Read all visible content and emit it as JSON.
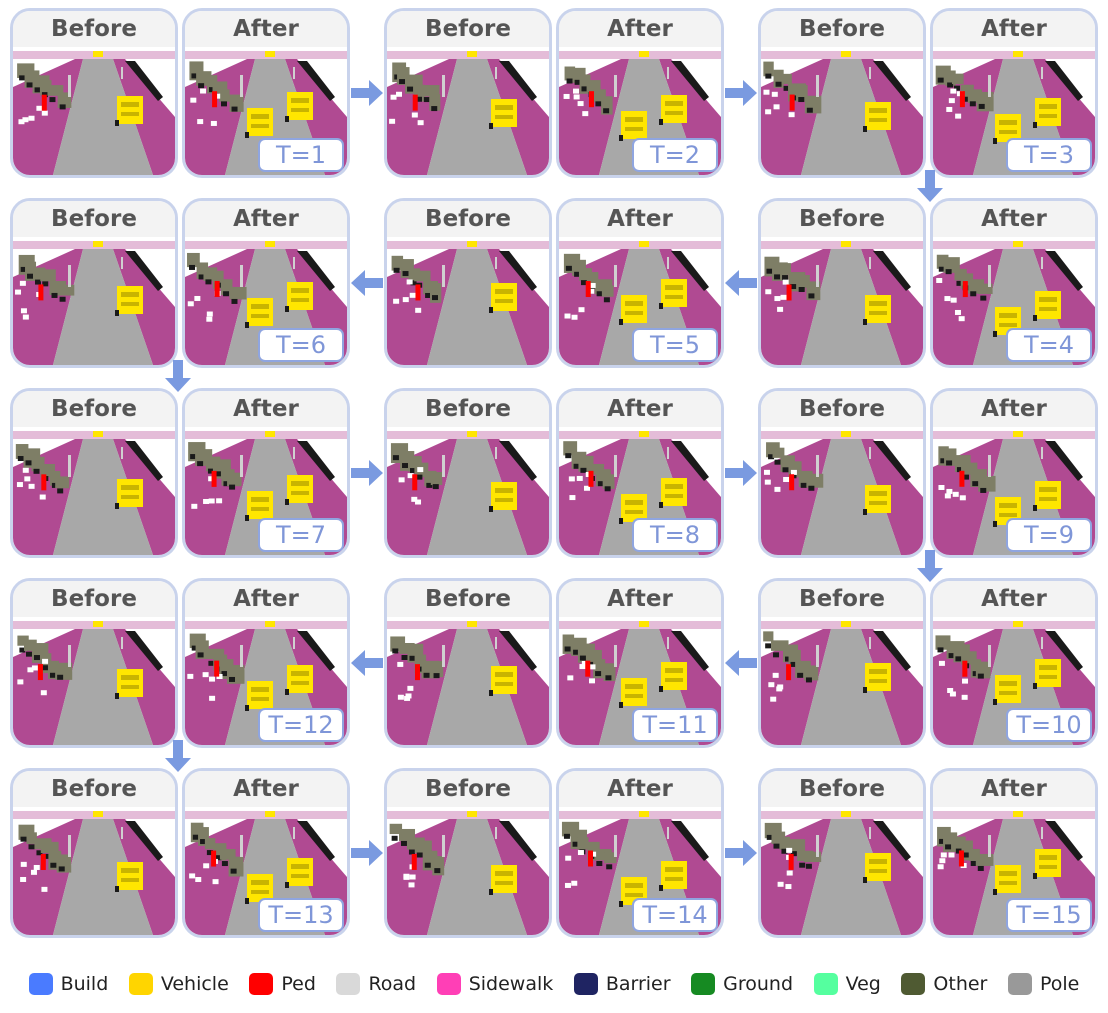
{
  "labels": {
    "before": "Before",
    "after": "After"
  },
  "time_steps": [
    "T=1",
    "T=2",
    "T=3",
    "T=4",
    "T=5",
    "T=6",
    "T=7",
    "T=8",
    "T=9",
    "T=10",
    "T=11",
    "T=12",
    "T=13",
    "T=14",
    "T=15"
  ],
  "legend": [
    {
      "label": "Build",
      "color": "#4a7bff"
    },
    {
      "label": "Vehicle",
      "color": "#ffd500"
    },
    {
      "label": "Ped",
      "color": "#ff0000"
    },
    {
      "label": "Road",
      "color": "#d9d9d9"
    },
    {
      "label": "Sidewalk",
      "color": "#ff3fb6"
    },
    {
      "label": "Barrier",
      "color": "#1f2462"
    },
    {
      "label": "Ground",
      "color": "#168a22"
    },
    {
      "label": "Veg",
      "color": "#55ff9f"
    },
    {
      "label": "Other",
      "color": "#4f5a32"
    },
    {
      "label": "Pole",
      "color": "#999999"
    }
  ],
  "scene_colors": {
    "road": "#a8a8a8",
    "sidewalk": "#b04a92",
    "building": "#7e7e66",
    "vehicle": "#ffe600",
    "pedestrian": "#ff0000",
    "pole": "#d0d0d0",
    "shadow": "#1a1a1a",
    "sky": "#ffffff",
    "distant": "#d8a0c8",
    "arrow": "#7a9ae0"
  }
}
